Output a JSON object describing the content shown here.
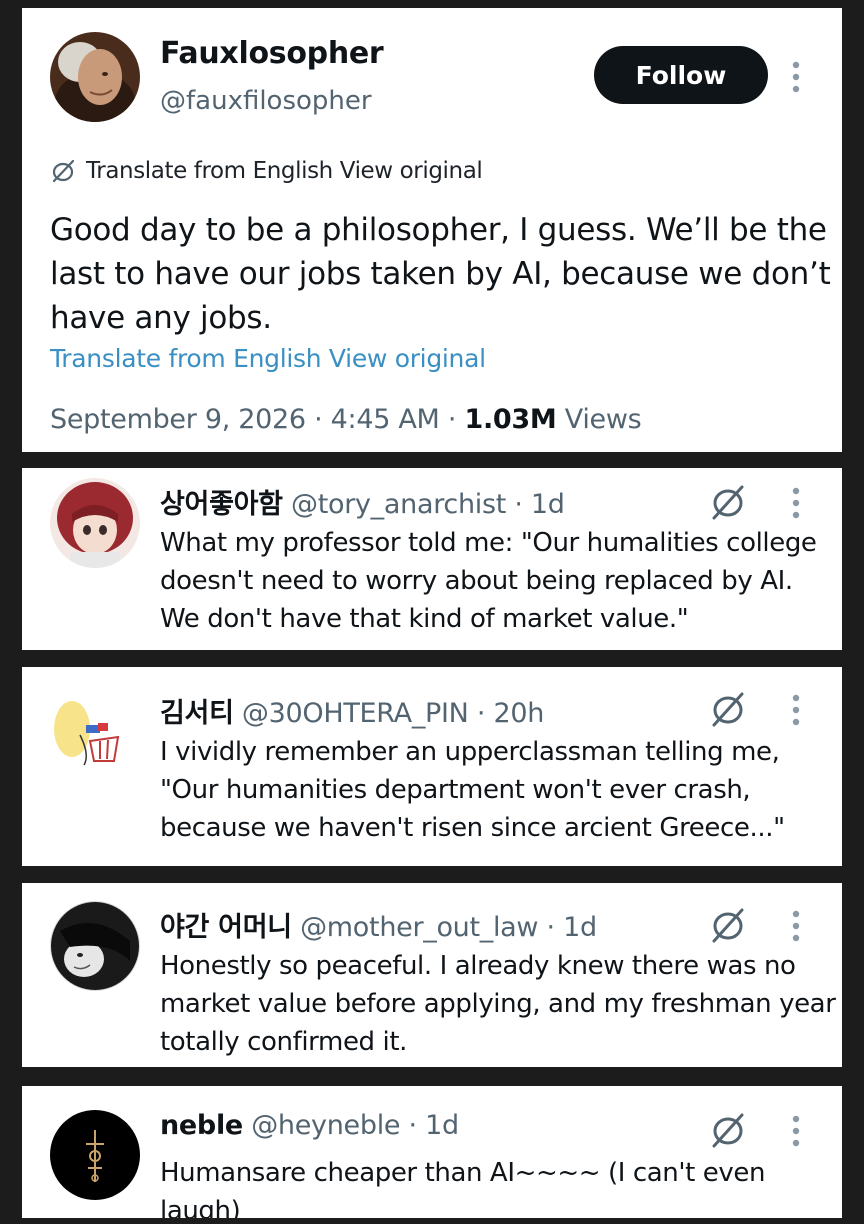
{
  "main_post": {
    "display_name": "Fauxlosopher",
    "handle": "@fauxfilosopher",
    "follow_label": "Follow",
    "translate_note": "Translate from English View original",
    "text": "Good day to be a philosopher, I guess. We’ll be the last to have our jobs taken by AI, because we don’t have any jobs.",
    "translate_label": "Translate from English",
    "view_original_label": "View original",
    "date": "September 9, 2026",
    "time": "4:45 AM",
    "views_count": "1.03M",
    "views_label": "Views"
  },
  "replies": [
    {
      "display_name": "상어좋아함",
      "handle": "@tory_anarchist",
      "age": "1d",
      "text": "What my professor told me: \"Our humalities college doesn't need to worry about being replaced by AI. We don't have that kind of market value.\""
    },
    {
      "display_name": "김서티",
      "handle": "@30OHTERA_PIN",
      "age": "20h",
      "text": "I vividly remember an upperclassman telling me, \"Our humanities department won't ever crash, because we haven't risen since arcient Greece...\""
    },
    {
      "display_name": "야간 어머니",
      "handle": "@mother_out_law",
      "age": "1d",
      "text": "Honestly so peaceful. I already knew there was no market value before applying, and my freshman year totally confirmed it."
    },
    {
      "display_name": "neble",
      "handle": "@heyneble",
      "age": "1d",
      "text": "Humansare cheaper than AI~~~~ (I can't even laugh)"
    }
  ],
  "separator": "·",
  "icons": {
    "translate": "translate-icon",
    "more": "more-vertical-icon"
  },
  "colors": {
    "follow_button": "#0f1419",
    "link_blue": "#3a8fc3",
    "secondary_text": "#536471",
    "background": "#1c1c1c"
  }
}
